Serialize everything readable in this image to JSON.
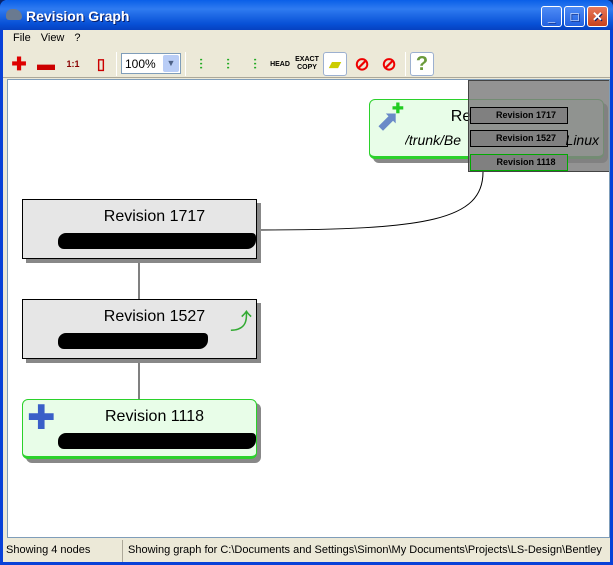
{
  "window": {
    "title": "Revision Graph"
  },
  "menu": [
    "File",
    "View",
    "?"
  ],
  "toolbar": {
    "zoom_in": "zoom-in",
    "zoom_out": "zoom-out",
    "zoom_1to1": "1:1",
    "zoom_value": "100%",
    "head_label": "HEAD",
    "exact_copy_label": "EXACT COPY",
    "help": "?"
  },
  "nodes": [
    {
      "revision": "Revision 1717",
      "path": "/trunk/Be",
      "path_end": "Linux",
      "type": "added-copy",
      "color": "#2bd12b"
    },
    {
      "revision": "Revision 1717"
    },
    {
      "revision": "Revision 1527",
      "type": "renamed"
    },
    {
      "revision": "Revision 1118",
      "type": "added",
      "color": "#2bd12b"
    }
  ],
  "overview": [
    "Revision 1717",
    "Revision 1527",
    "Revision 1118"
  ],
  "status": {
    "count": "Showing 4 nodes",
    "path": "Showing graph for C:\\Documents and Settings\\Simon\\My Documents\\Projects\\LS-Design\\Bentley"
  }
}
